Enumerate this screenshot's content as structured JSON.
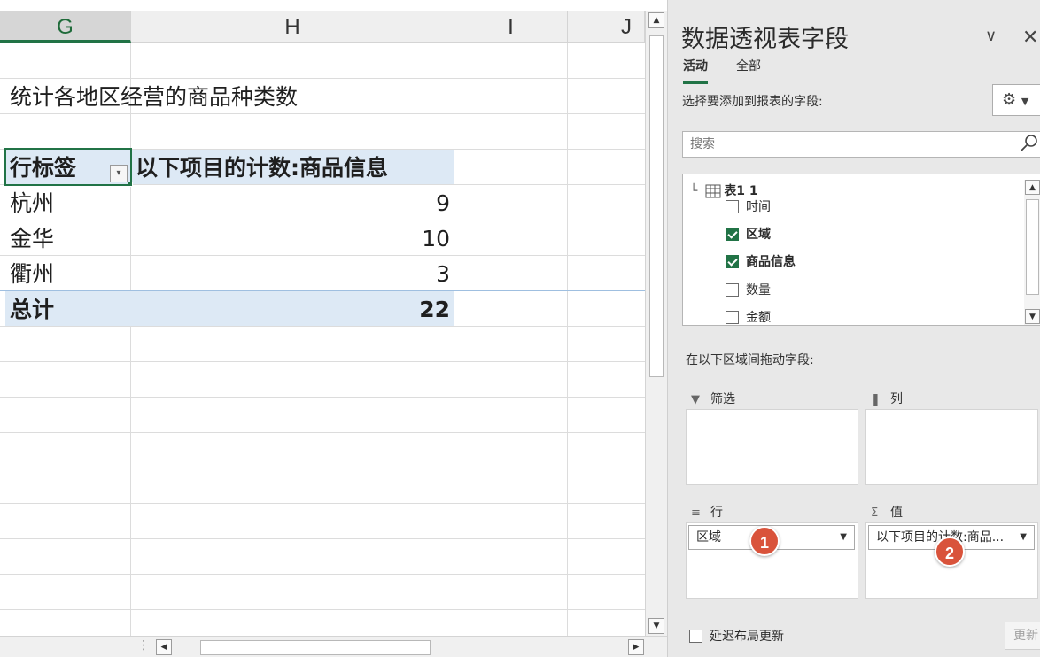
{
  "sheet": {
    "columns": [
      "G",
      "H",
      "I",
      "J"
    ],
    "selected_column": "G",
    "title_cell": "统计各地区经营的商品种类数",
    "pivot": {
      "header_row_label": "行标签",
      "header_value_label": "以下项目的计数:商品信息",
      "rows": [
        {
          "label": "杭州",
          "value": "9"
        },
        {
          "label": "金华",
          "value": "10"
        },
        {
          "label": "衢州",
          "value": "3"
        }
      ],
      "total_label": "总计",
      "total_value": "22"
    }
  },
  "pane": {
    "title": "数据透视表字段",
    "tabs": [
      "活动",
      "全部"
    ],
    "choose_label": "选择要添加到报表的字段:",
    "search_placeholder": "搜索",
    "table_name": "表1 1",
    "fields": [
      {
        "label": "时间",
        "checked": false
      },
      {
        "label": "区域",
        "checked": true
      },
      {
        "label": "商品信息",
        "checked": true
      },
      {
        "label": "数量",
        "checked": false
      },
      {
        "label": "金额",
        "checked": false
      }
    ],
    "drag_label": "在以下区域间拖动字段:",
    "areas": {
      "filter": "筛选",
      "columns": "列",
      "rows": "行",
      "values": "值"
    },
    "row_field": "区域",
    "value_field": "以下项目的计数:商品...",
    "badges": [
      "1",
      "2"
    ],
    "defer_label": "延迟布局更新",
    "update_label": "更新"
  },
  "colors": {
    "accent": "#217346",
    "pivot_header_band": "#dde9f5",
    "badge": "#d9533b"
  }
}
